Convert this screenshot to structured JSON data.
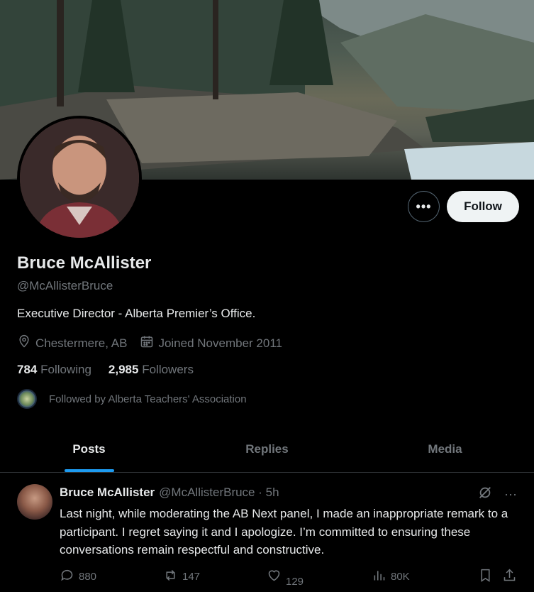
{
  "profile": {
    "name": "Bruce McAllister",
    "handle": "@McAllisterBruce",
    "bio": "Executive Director - Alberta Premier’s Office.",
    "location": "Chestermere, AB",
    "joined": "Joined November 2011",
    "following_count": "784",
    "following_label": "Following",
    "followers_count": "2,985",
    "followers_label": "Followers",
    "followed_by": "Followed by Alberta Teachers' Association"
  },
  "buttons": {
    "more": "•••",
    "follow": "Follow"
  },
  "tabs": [
    {
      "label": "Posts",
      "active": true
    },
    {
      "label": "Replies",
      "active": false
    },
    {
      "label": "Media",
      "active": false
    }
  ],
  "post": {
    "author": "Bruce McAllister",
    "handle_time": "@McAllisterBruce · 5h",
    "text": "Last night, while moderating the AB Next panel, I made an inappropriate remark to a participant. I regret saying it and I apologize. I’m committed to ensuring these conversations remain respectful and constructive.",
    "more": "···",
    "replies": "880",
    "reposts": "147",
    "likes": "129",
    "views": "80K"
  },
  "colors": {
    "accent": "#1d9bf0",
    "muted": "#71767b",
    "text": "#e7e9ea",
    "background": "#000000"
  }
}
